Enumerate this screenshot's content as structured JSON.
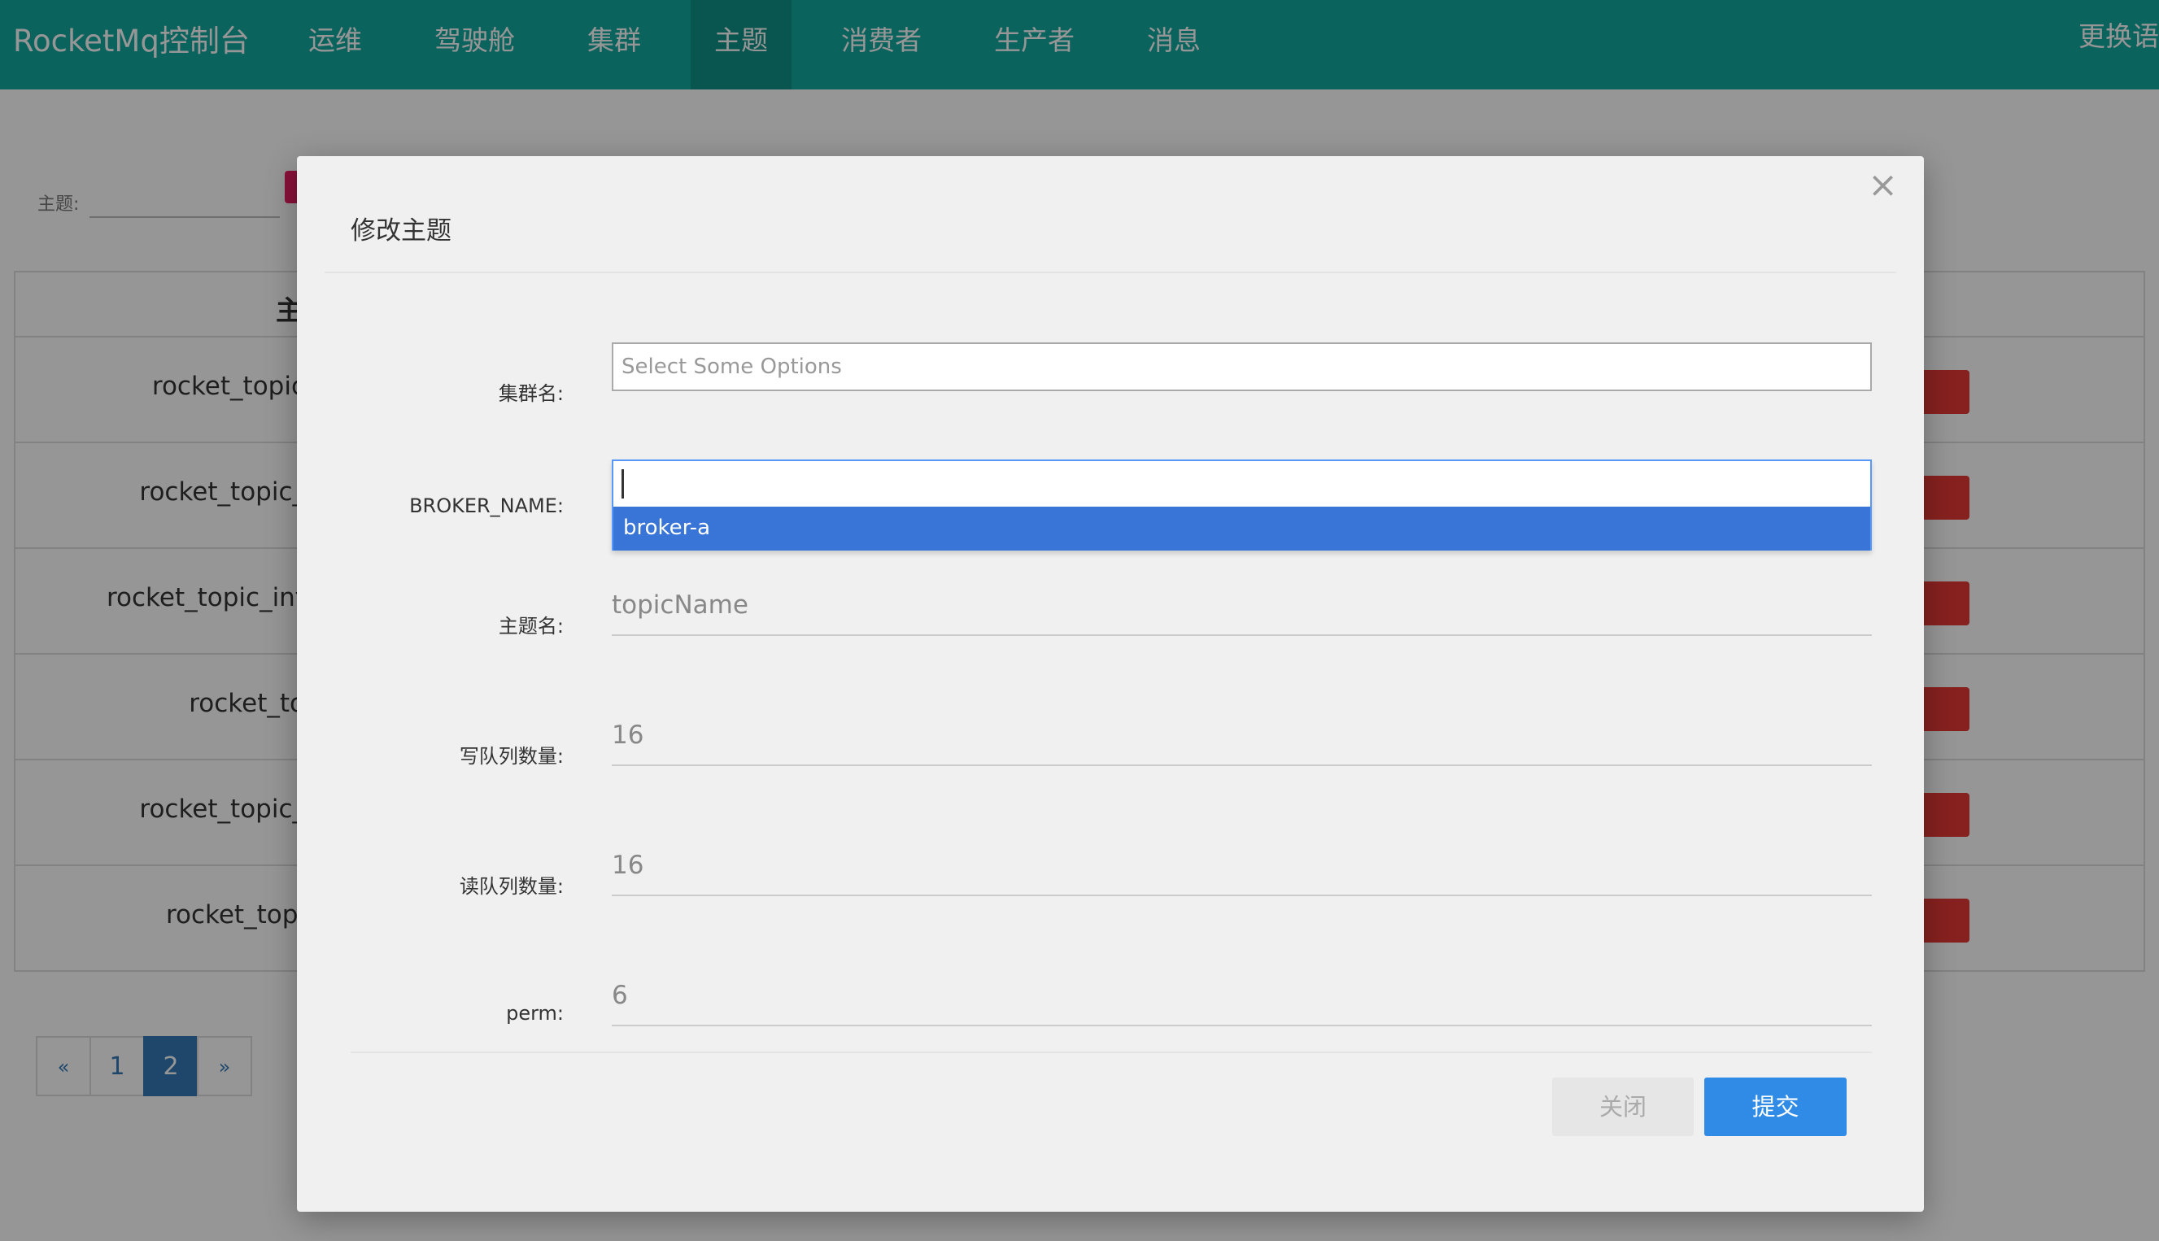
{
  "navbar": {
    "brand": "RocketMq控制台",
    "items": [
      {
        "label": "运维"
      },
      {
        "label": "驾驶舱"
      },
      {
        "label": "集群"
      },
      {
        "label": "主题",
        "active": true
      },
      {
        "label": "消费者"
      },
      {
        "label": "生产者"
      },
      {
        "label": "消息"
      }
    ],
    "language": "更换语"
  },
  "filter": {
    "label": "主题:"
  },
  "table": {
    "header": "主",
    "rows": [
      {
        "name": "rocket_topic"
      },
      {
        "name": "rocket_topic_"
      },
      {
        "name": "rocket_topic_int"
      },
      {
        "name": "rocket_to"
      },
      {
        "name": "rocket_topic_"
      },
      {
        "name": "rocket_topi"
      }
    ]
  },
  "pagination": {
    "prev": "«",
    "pages": [
      "1",
      "2"
    ],
    "current": "2",
    "next": "»"
  },
  "modal": {
    "title": "修改主题",
    "close_icon": "×",
    "fields": {
      "cluster": {
        "label": "集群名:",
        "placeholder": "Select Some Options"
      },
      "broker": {
        "label": "BROKER_NAME:",
        "search_value": "",
        "option": "broker-a"
      },
      "topic": {
        "label": "主题名:",
        "placeholder": "topicName"
      },
      "write_queue": {
        "label": "写队列数量:",
        "value": "16"
      },
      "read_queue": {
        "label": "读队列数量:",
        "value": "16"
      },
      "perm": {
        "label": "perm:",
        "value": "6"
      }
    },
    "buttons": {
      "close": "关闭",
      "submit": "提交"
    }
  },
  "colors": {
    "navbar": "#13a89e",
    "primary": "#2f8be6",
    "highlight": "#3875d7",
    "danger": "#e53935"
  }
}
